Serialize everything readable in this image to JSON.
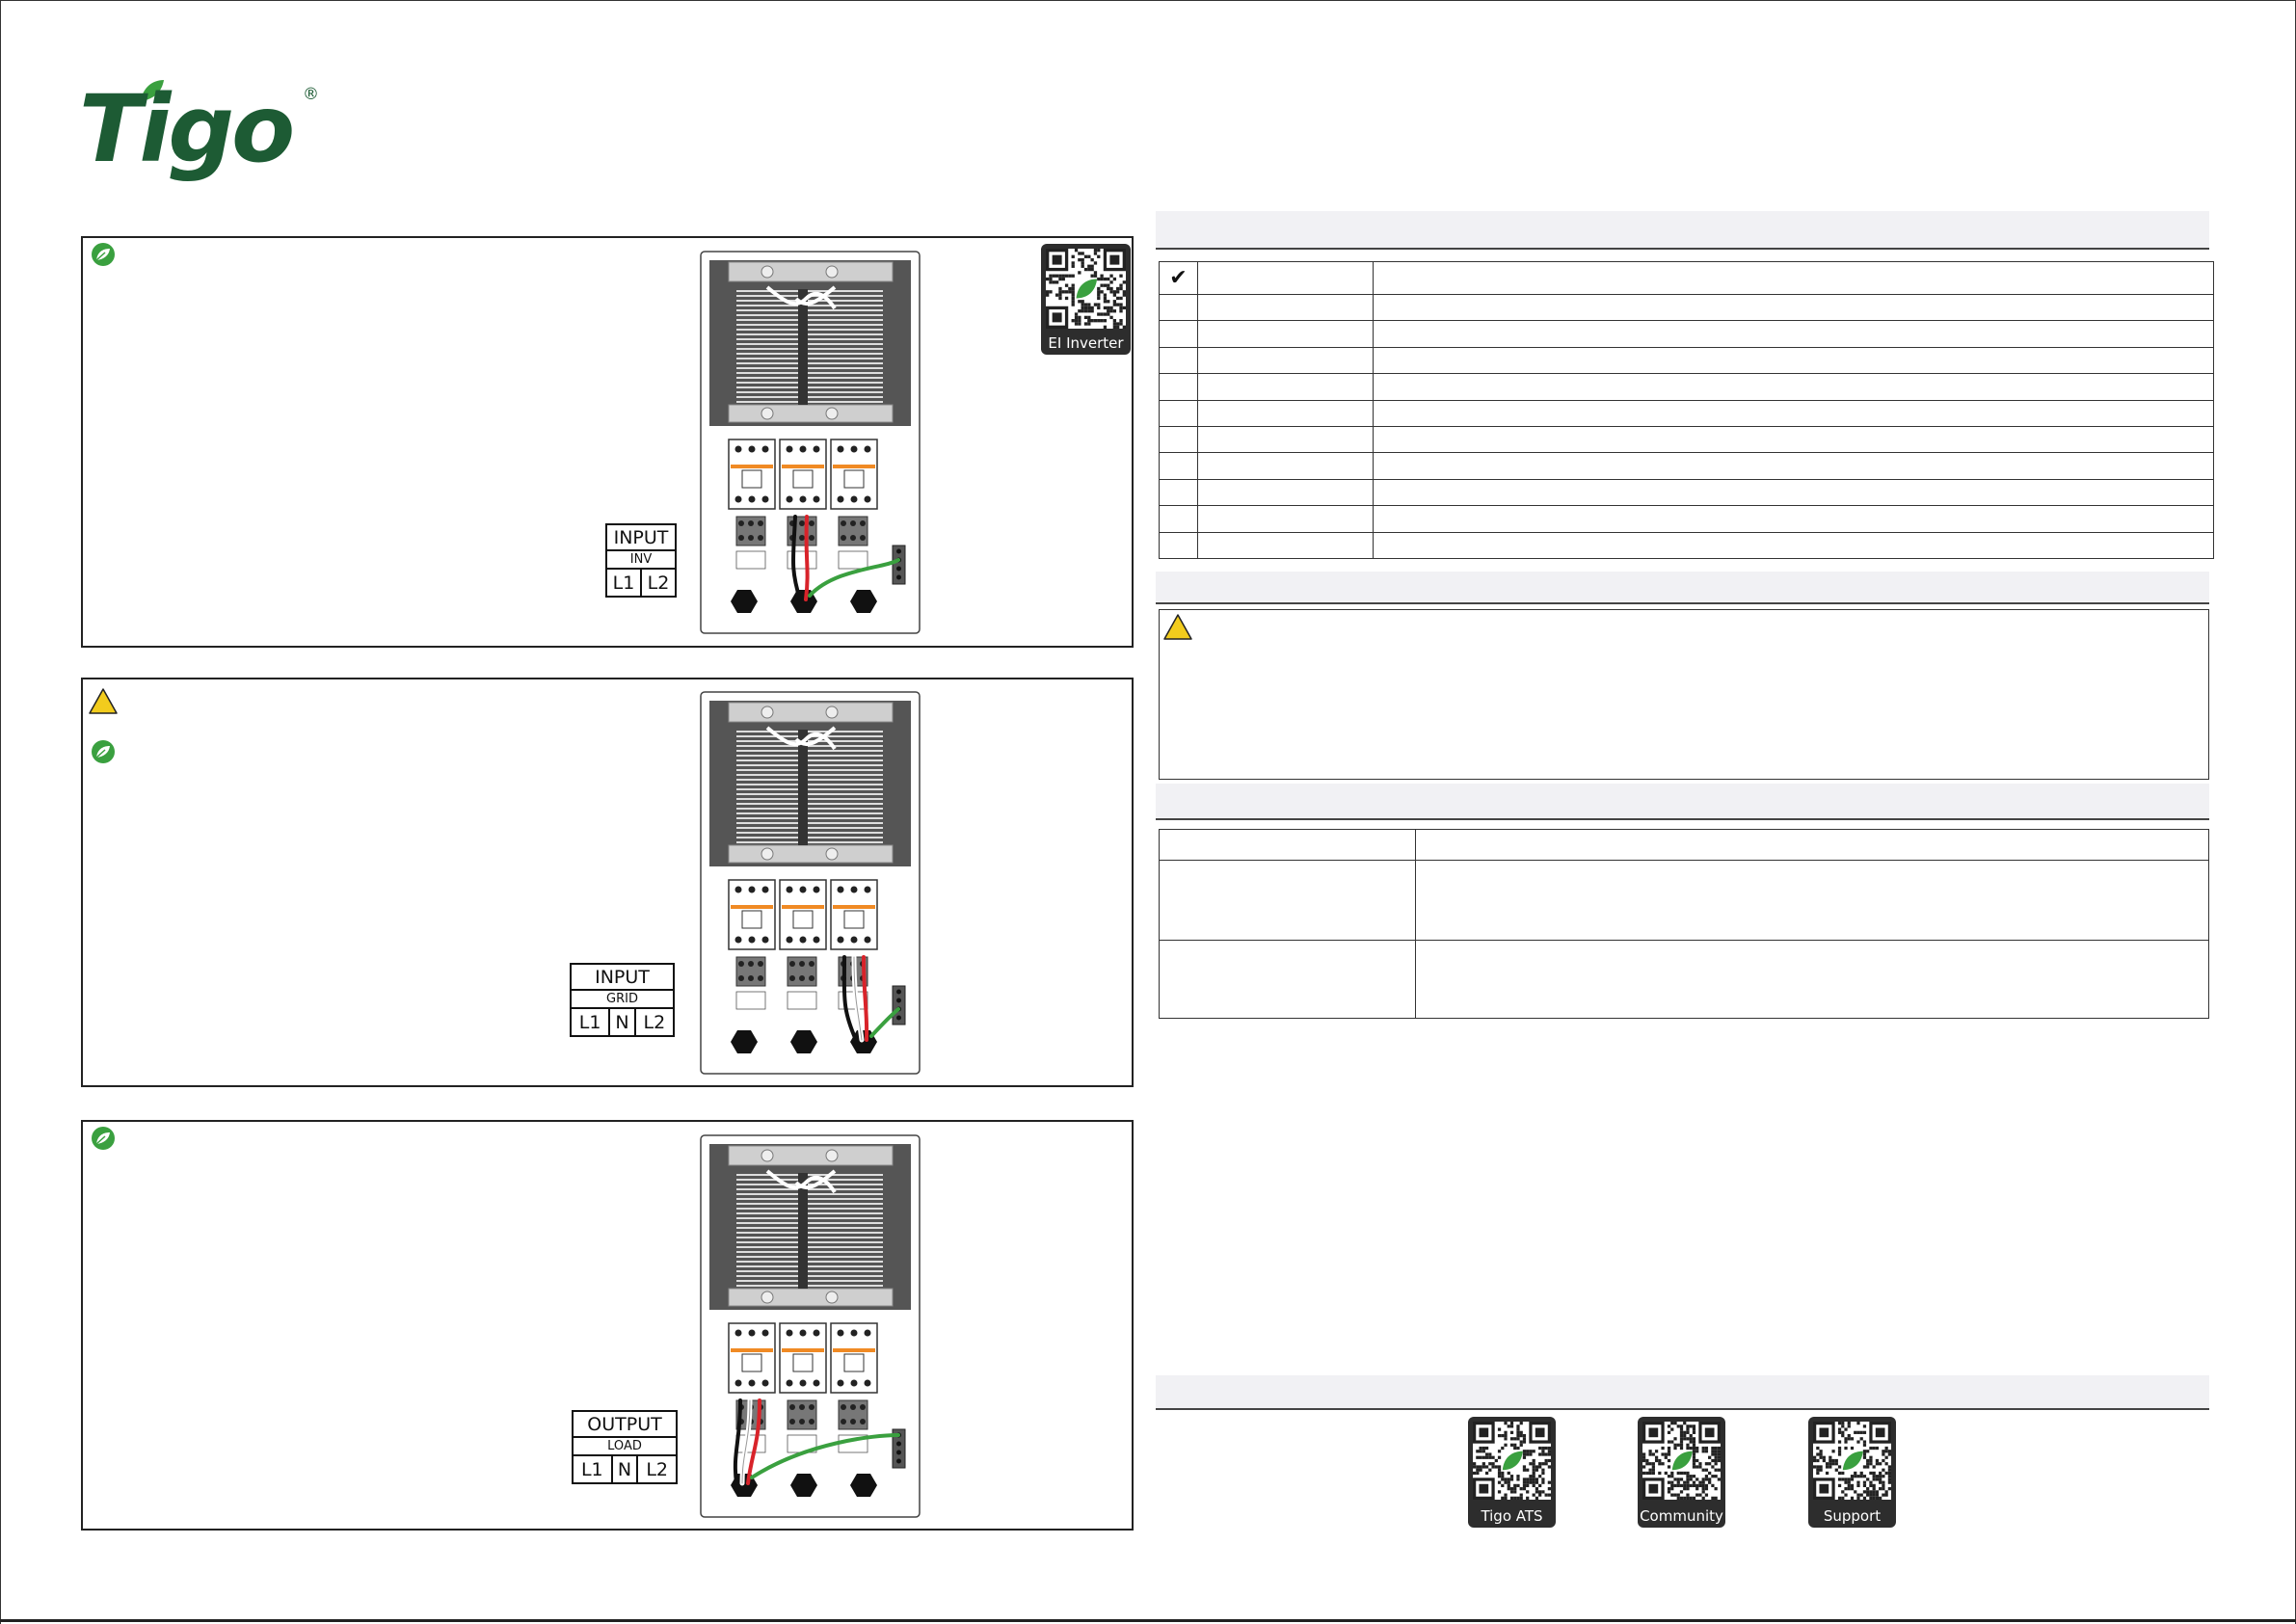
{
  "brand": {
    "name": "Tigo",
    "registered_mark": "®"
  },
  "panels": [
    {
      "label": {
        "title": "INPUT",
        "subtitle": "INV",
        "terminals": [
          "L1",
          "L2"
        ]
      }
    },
    {
      "label": {
        "title": "INPUT",
        "subtitle": "GRID",
        "terminals": [
          "L1",
          "N",
          "L2"
        ]
      }
    },
    {
      "label": {
        "title": "OUTPUT",
        "subtitle": "LOAD",
        "terminals": [
          "L1",
          "N",
          "L2"
        ]
      }
    }
  ],
  "qr_codes": {
    "inverter": "EI Inverter",
    "footer": [
      "Tigo ATS",
      "Community",
      "Support"
    ]
  },
  "checklist": {
    "check_symbol": "✔",
    "rows": 11
  },
  "colors": {
    "brand_green": "#1d5b34",
    "leaf_green": "#3aa03f",
    "warning_yellow": "#f2cc1d"
  }
}
